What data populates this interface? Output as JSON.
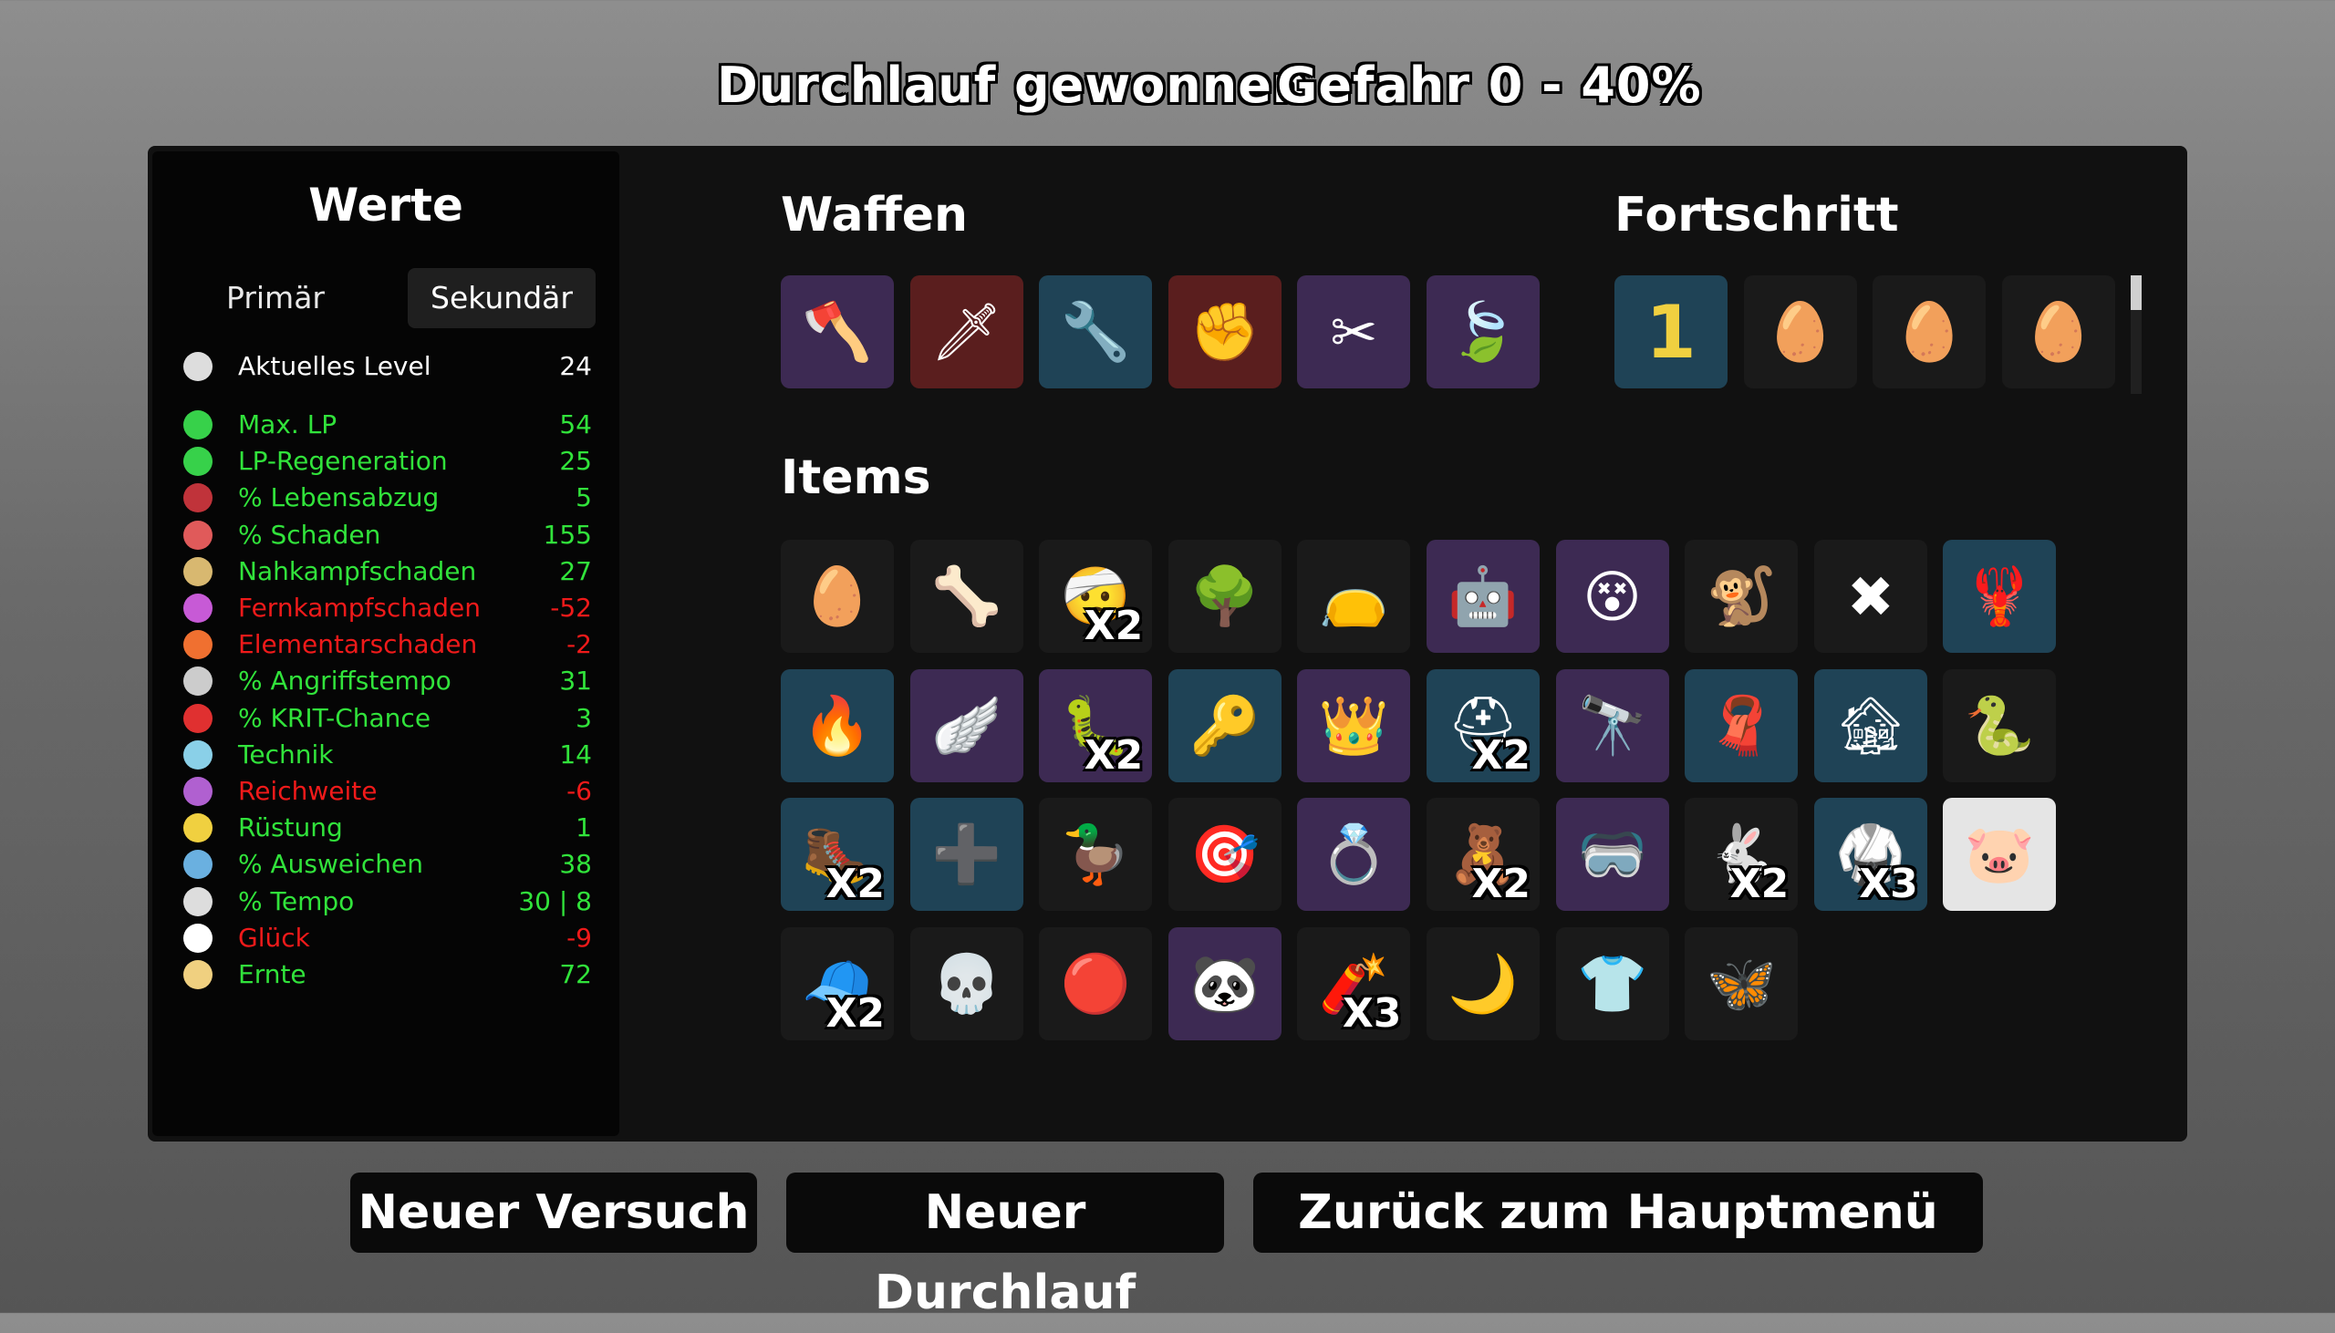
{
  "header": {
    "run_result": "Durchlauf gewonnen",
    "danger": "Gefahr 0 - 40%"
  },
  "stats": {
    "title": "Werte",
    "tab_primary": "Primär",
    "tab_secondary": "Sekundär",
    "level": {
      "label": "Aktuelles Level",
      "value": "24",
      "icon": "level-icon"
    },
    "rows": [
      {
        "label": "Max. LP",
        "value": "54",
        "color": "green",
        "icon": "heart-icon"
      },
      {
        "label": "LP-Regeneration",
        "value": "25",
        "color": "green",
        "icon": "heart-plus-icon"
      },
      {
        "label": "% Lebensabzug",
        "value": "5",
        "color": "green",
        "icon": "fangs-icon"
      },
      {
        "label": "% Schaden",
        "value": "155",
        "color": "green",
        "icon": "muscle-icon"
      },
      {
        "label": "Nahkampfschaden",
        "value": "27",
        "color": "green",
        "icon": "sword-icon"
      },
      {
        "label": "Fernkampfschaden",
        "value": "-52",
        "color": "red",
        "icon": "bow-icon"
      },
      {
        "label": "Elementarschaden",
        "value": "-2",
        "color": "red",
        "icon": "flame-icon"
      },
      {
        "label": "% Angriffstempo",
        "value": "31",
        "color": "green",
        "icon": "hourglass-icon"
      },
      {
        "label": "% KRIT-Chance",
        "value": "3",
        "color": "green",
        "icon": "crit-icon"
      },
      {
        "label": "Technik",
        "value": "14",
        "color": "green",
        "icon": "wrench-cross-icon"
      },
      {
        "label": "Reichweite",
        "value": "-6",
        "color": "red",
        "icon": "range-icon"
      },
      {
        "label": "Rüstung",
        "value": "1",
        "color": "green",
        "icon": "shield-icon"
      },
      {
        "label": "% Ausweichen",
        "value": "38",
        "color": "green",
        "icon": "dodge-icon"
      },
      {
        "label": "% Tempo",
        "value": "30 | 8",
        "color": "green",
        "icon": "boot-icon"
      },
      {
        "label": "Glück",
        "value": "-9",
        "color": "red",
        "icon": "dice-icon"
      },
      {
        "label": "Ernte",
        "value": "72",
        "color": "green",
        "icon": "harvest-icon"
      }
    ]
  },
  "weapons": {
    "title": "Waffen",
    "slots": [
      {
        "icon": "axe-icon",
        "glyph": "🪓",
        "tier": "purple"
      },
      {
        "icon": "spear-icon",
        "glyph": "🗡",
        "tier": "red"
      },
      {
        "icon": "wrench-icon",
        "glyph": "🔧",
        "tier": "blue"
      },
      {
        "icon": "fist-icon",
        "glyph": "✊",
        "tier": "red"
      },
      {
        "icon": "pruner-icon",
        "glyph": "✂",
        "tier": "purple"
      },
      {
        "icon": "leaf-icon",
        "glyph": "🍃",
        "tier": "purple"
      }
    ]
  },
  "progress": {
    "title": "Fortschritt",
    "slots": [
      {
        "icon": "number-one-icon",
        "glyph": "1",
        "tier": "blue"
      },
      {
        "icon": "egg-face-icon",
        "glyph": "🥚",
        "tier": "dark"
      },
      {
        "icon": "egg-face-bearded-icon",
        "glyph": "🥚",
        "tier": "dark"
      },
      {
        "icon": "egg-face-clown-icon",
        "glyph": "🥚",
        "tier": "dark"
      }
    ]
  },
  "items": {
    "title": "Items",
    "slots": [
      {
        "icon": "egg-face-icon",
        "glyph": "🥚",
        "tier": "dark",
        "count": ""
      },
      {
        "icon": "flesh-icon",
        "glyph": "🦴",
        "tier": "dark",
        "count": ""
      },
      {
        "icon": "bandage-head-icon",
        "glyph": "🤕",
        "tier": "dark",
        "count": "X2"
      },
      {
        "icon": "tree-icon",
        "glyph": "🌳",
        "tier": "dark",
        "count": ""
      },
      {
        "icon": "sack-icon",
        "glyph": "👝",
        "tier": "dark",
        "count": ""
      },
      {
        "icon": "turret-icon",
        "glyph": "🤖",
        "tier": "purple",
        "count": ""
      },
      {
        "icon": "pink-blob-icon",
        "glyph": "😵",
        "tier": "purple",
        "count": ""
      },
      {
        "icon": "monkey-icon",
        "glyph": "🐒",
        "tier": "dark",
        "count": ""
      },
      {
        "icon": "red-cross-icon",
        "glyph": "✖",
        "tier": "dark",
        "count": ""
      },
      {
        "icon": "claw-icon",
        "glyph": "🦞",
        "tier": "blue",
        "count": ""
      },
      {
        "icon": "campfire-icon",
        "glyph": "🔥",
        "tier": "blue",
        "count": ""
      },
      {
        "icon": "wings-icon",
        "glyph": "🪽",
        "tier": "purple",
        "count": ""
      },
      {
        "icon": "tardigrade-icon",
        "glyph": "🐛",
        "tier": "purple",
        "count": "X2"
      },
      {
        "icon": "wind-up-key-icon",
        "glyph": "🔑",
        "tier": "blue",
        "count": ""
      },
      {
        "icon": "crown-icon",
        "glyph": "👑",
        "tier": "purple",
        "count": ""
      },
      {
        "icon": "helmet-icon",
        "glyph": "⛑",
        "tier": "blue",
        "count": "X2"
      },
      {
        "icon": "cannon-icon",
        "glyph": "🔭",
        "tier": "purple",
        "count": ""
      },
      {
        "icon": "scarf-icon",
        "glyph": "🧣",
        "tier": "blue",
        "count": ""
      },
      {
        "icon": "cottage-icon",
        "glyph": "🏚",
        "tier": "blue",
        "count": ""
      },
      {
        "icon": "snake-icon",
        "glyph": "🐍",
        "tier": "dark",
        "count": ""
      },
      {
        "icon": "boots-icon",
        "glyph": "🥾",
        "tier": "blue",
        "count": "X2"
      },
      {
        "icon": "medic-turret-icon",
        "glyph": "➕",
        "tier": "blue",
        "count": ""
      },
      {
        "icon": "duck-icon",
        "glyph": "🦆",
        "tier": "dark",
        "count": ""
      },
      {
        "icon": "target-turret-icon",
        "glyph": "🎯",
        "tier": "dark",
        "count": ""
      },
      {
        "icon": "ring-icon",
        "glyph": "💍",
        "tier": "purple",
        "count": ""
      },
      {
        "icon": "teddy-icon",
        "glyph": "🧸",
        "tier": "dark",
        "count": "X2"
      },
      {
        "icon": "goggles-icon",
        "glyph": "🥽",
        "tier": "purple",
        "count": ""
      },
      {
        "icon": "rabbit-icon",
        "glyph": "🐇",
        "tier": "dark",
        "count": "X2"
      },
      {
        "icon": "belt-icon",
        "glyph": "🥋",
        "tier": "blue",
        "count": "X3"
      },
      {
        "icon": "piggy-bank-icon",
        "glyph": "🐷",
        "tier": "white",
        "count": ""
      },
      {
        "icon": "beanie-icon",
        "glyph": "🧢",
        "tier": "dark",
        "count": "X2"
      },
      {
        "icon": "skull-icon",
        "glyph": "💀",
        "tier": "dark",
        "count": ""
      },
      {
        "icon": "button-icon",
        "glyph": "🔴",
        "tier": "dark",
        "count": ""
      },
      {
        "icon": "panda-icon",
        "glyph": "🐼",
        "tier": "purple",
        "count": ""
      },
      {
        "icon": "dynamite-icon",
        "glyph": "🧨",
        "tier": "dark",
        "count": "X3"
      },
      {
        "icon": "moon-icon",
        "glyph": "🌙",
        "tier": "dark",
        "count": ""
      },
      {
        "icon": "shirt-icon",
        "glyph": "👕",
        "tier": "dark",
        "count": ""
      },
      {
        "icon": "butterfly-icon",
        "glyph": "🦋",
        "tier": "dark",
        "count": ""
      }
    ]
  },
  "buttons": {
    "retry": "Neuer Versuch",
    "new_run": "Neuer Durchlauf",
    "main_menu": "Zurück zum Hauptmenü"
  },
  "colors": {
    "green": "#31e33b",
    "red": "#f01a1a",
    "tier_blue": "#1f4356",
    "tier_purple": "#3d2a53",
    "tier_red": "#5a1e1e",
    "tier_dark": "#1a1a1a"
  }
}
